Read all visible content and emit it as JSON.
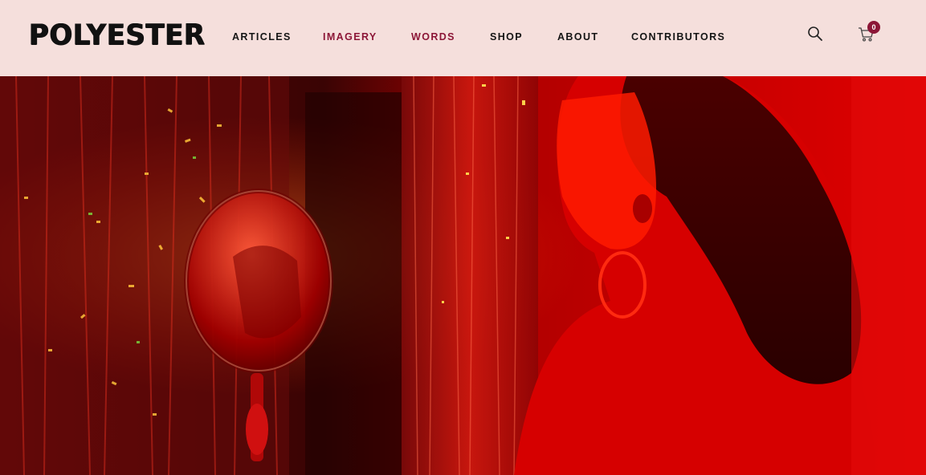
{
  "header": {
    "logo": "POLYESTER",
    "nav": [
      {
        "label": "ARTICLES",
        "accent": false
      },
      {
        "label": "IMAGERY",
        "accent": true
      },
      {
        "label": "WORDS",
        "accent": true
      },
      {
        "label": "SHOP",
        "accent": false
      },
      {
        "label": "ABOUT",
        "accent": false
      },
      {
        "label": "CONTRIBUTORS",
        "accent": false
      }
    ],
    "search_icon": "search-icon",
    "cart_icon": "shopping-cart-icon",
    "cart_count": "0"
  },
  "colors": {
    "header_bg": "#f5dfdc",
    "accent": "#8c1637",
    "text": "#151515"
  }
}
